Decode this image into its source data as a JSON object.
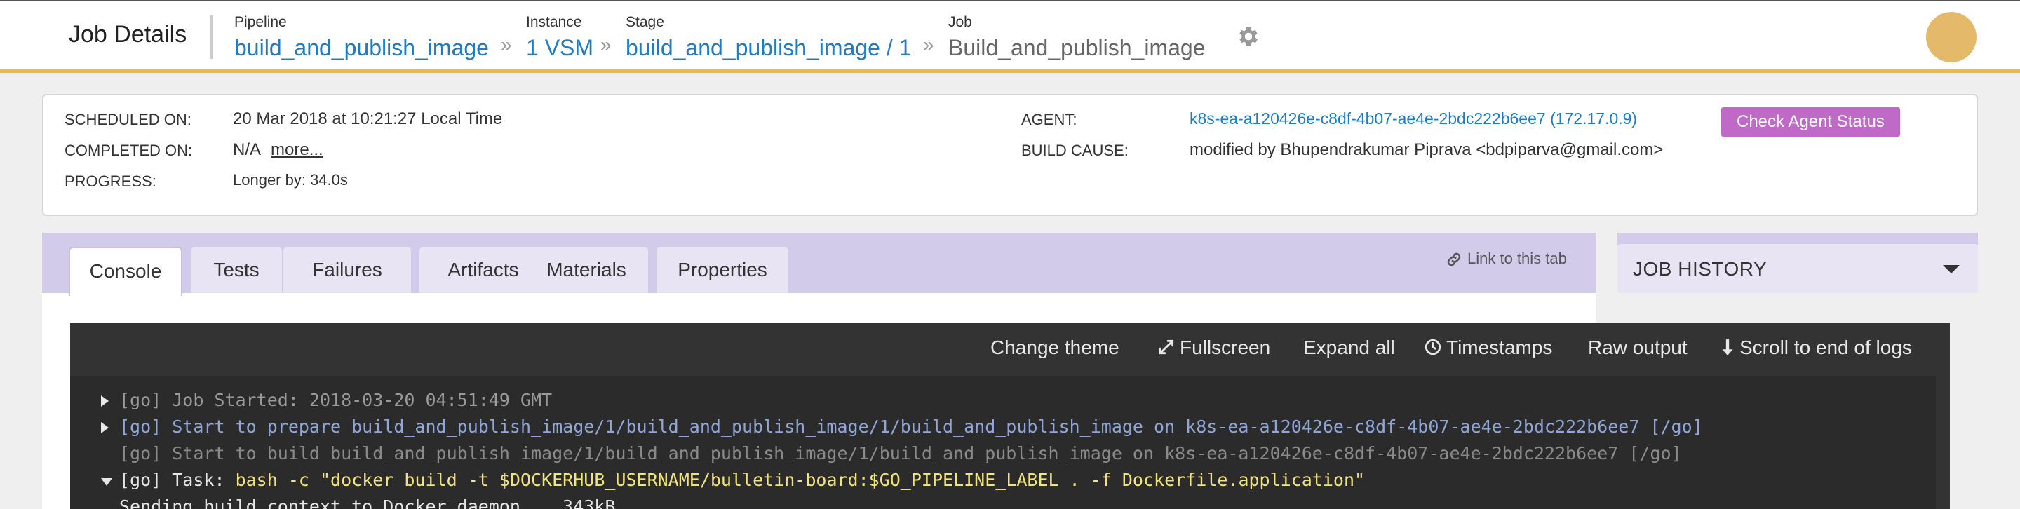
{
  "header": {
    "title": "Job Details",
    "breadcrumbs": [
      {
        "label": "Pipeline",
        "value": "build_and_publish_image"
      },
      {
        "label": "Instance",
        "value": "1 VSM"
      },
      {
        "label": "Stage",
        "value": "build_and_publish_image / 1"
      },
      {
        "label": "Job",
        "value": "Build_and_publish_image"
      }
    ],
    "separator": "»"
  },
  "info": {
    "scheduled_label": "SCHEDULED ON:",
    "scheduled_value": "20 Mar 2018 at 10:21:27 Local Time",
    "completed_label": "COMPLETED ON:",
    "completed_value": "N/A",
    "more_link": "more...",
    "progress_label": "PROGRESS:",
    "progress_value": "Longer by: 34.0s",
    "agent_label": "AGENT:",
    "agent_value": "k8s-ea-a120426e-c8df-4b07-ae4e-2bdc222b6ee7 (172.17.0.9)",
    "agent_button": "Check Agent Status",
    "cause_label": "BUILD CAUSE:",
    "cause_value": "modified by Bhupendrakumar Piprava <bdpiparva@gmail.com>"
  },
  "tabs": [
    {
      "label": "Console",
      "active": true
    },
    {
      "label": "Tests"
    },
    {
      "label": "Failures"
    },
    {
      "label": "Artifacts"
    },
    {
      "label": "Materials"
    },
    {
      "label": "Properties"
    }
  ],
  "link_tab": "Link to this tab",
  "job_history": {
    "title": "JOB HISTORY"
  },
  "console": {
    "toolbar": {
      "change_theme": "Change theme",
      "fullscreen": "Fullscreen",
      "expand_all": "Expand all",
      "timestamps": "Timestamps",
      "raw_output": "Raw output",
      "scroll_end": "Scroll to end of logs"
    },
    "lines": [
      {
        "text": "[go] Job Started: 2018-03-20 04:51:49 GMT"
      },
      {
        "text": "[go] Start to prepare build_and_publish_image/1/build_and_publish_image/1/build_and_publish_image on k8s-ea-a120426e-c8df-4b07-ae4e-2bdc222b6ee7 [/go]"
      },
      {
        "text": "[go] Start to build build_and_publish_image/1/build_and_publish_image/1/build_and_publish_image on k8s-ea-a120426e-c8df-4b07-ae4e-2bdc222b6ee7 [/go]"
      },
      {
        "prefix": "[go] Task: ",
        "command": "bash -c \"docker build -t $DOCKERHUB_USERNAME/bulletin-board:$GO_PIPELINE_LABEL . -f Dockerfile.application\""
      },
      {
        "text": "Sending build context to Docker daemon    343kB"
      }
    ]
  },
  "colors": {
    "header_accent": "#f5b936",
    "link": "#1f7cc2",
    "agent_button": "#c06ac7",
    "tab_bar": "#d3cbea",
    "console_bg": "#333333"
  }
}
